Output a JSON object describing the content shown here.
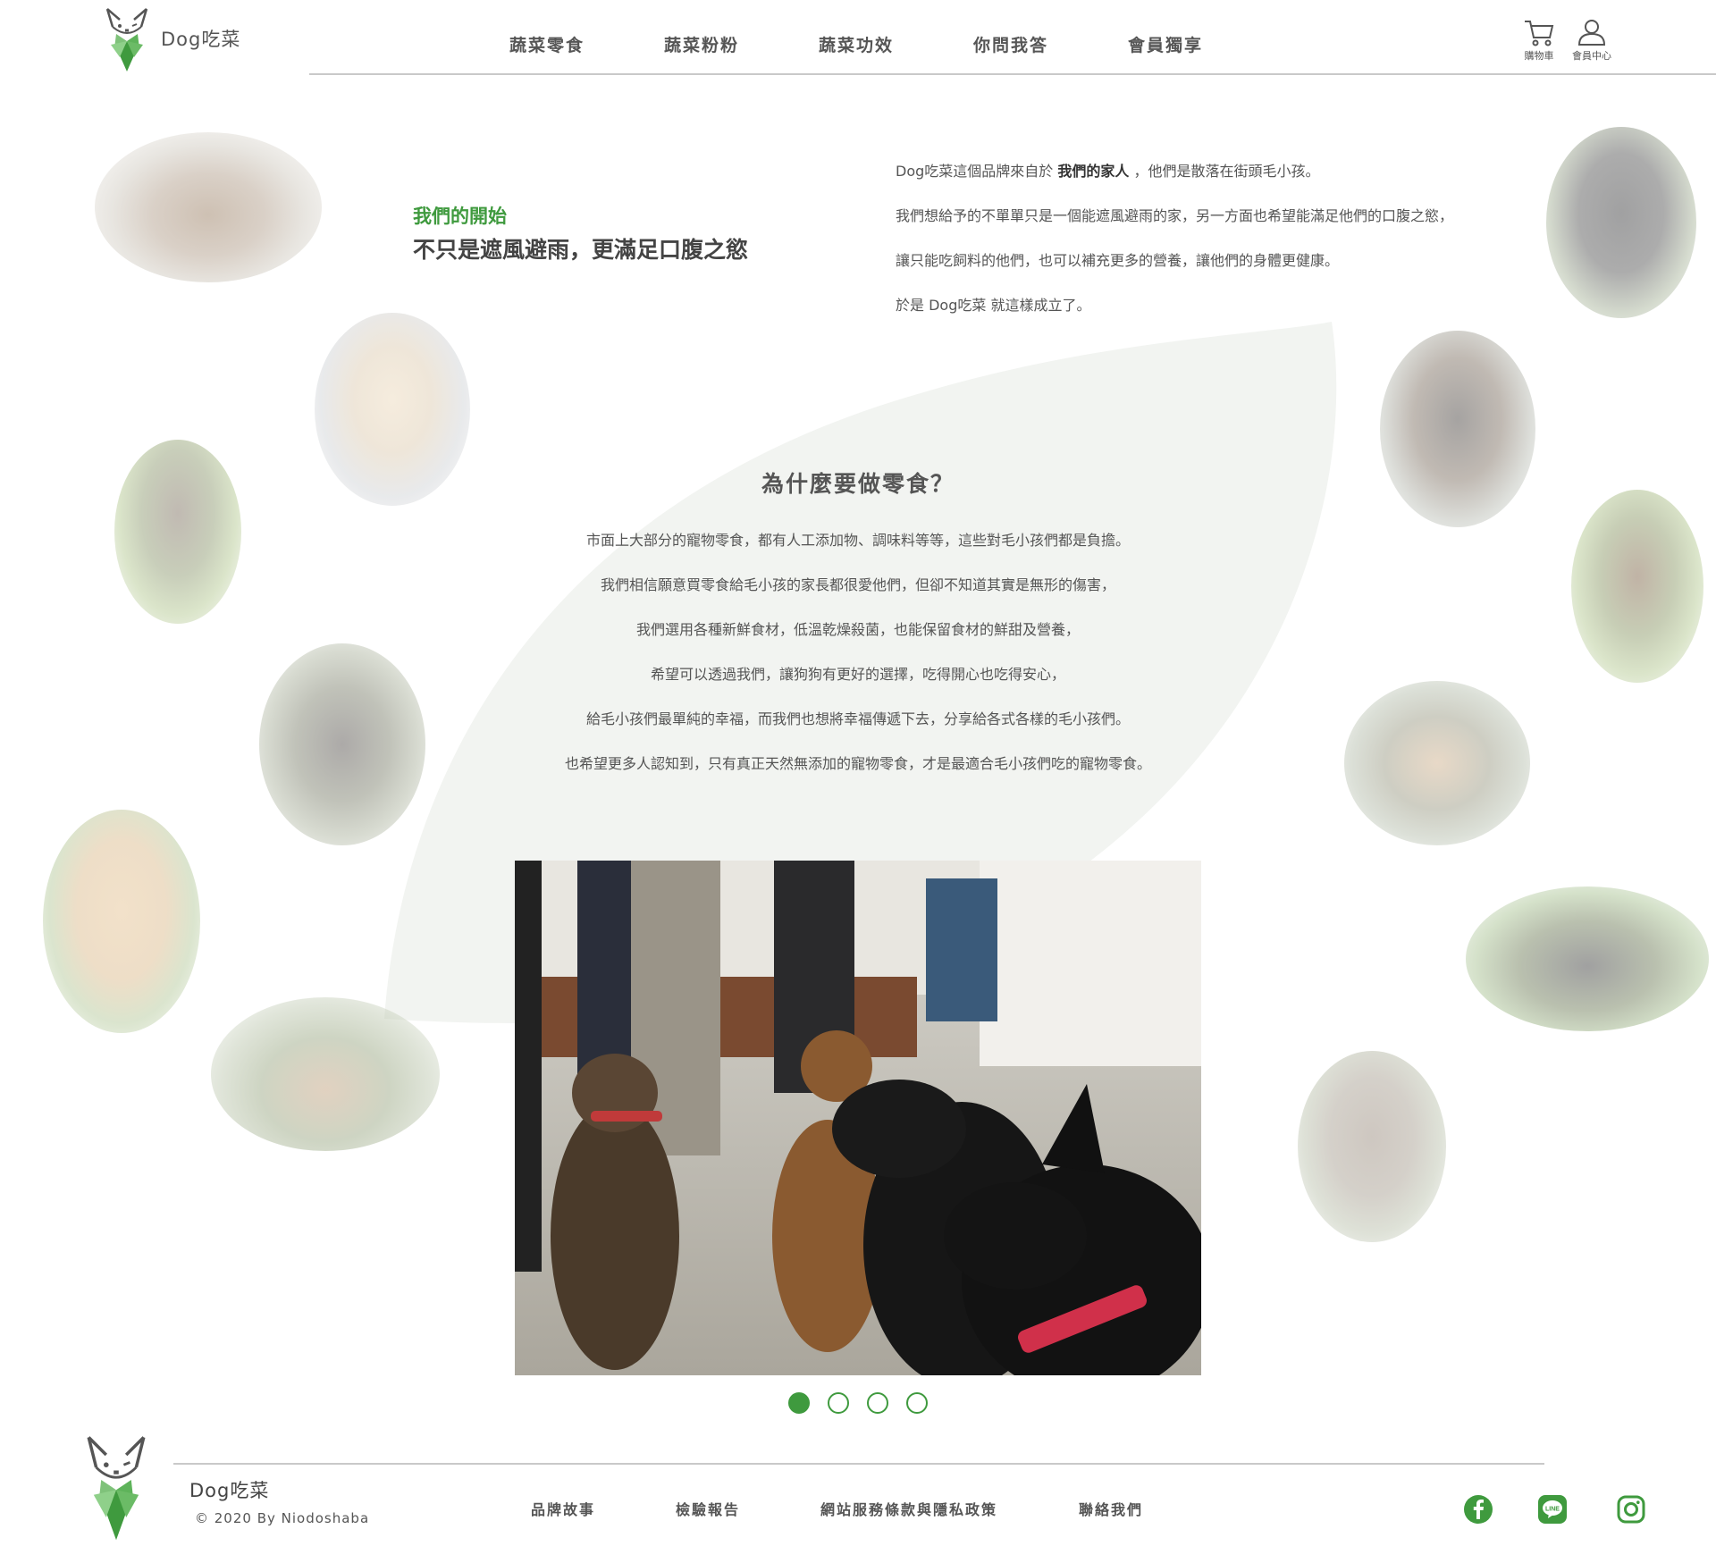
{
  "header": {
    "brand": "Dog吃菜",
    "nav": [
      "蔬菜零食",
      "蔬菜粉粉",
      "蔬菜功效",
      "你問我答",
      "會員獨享"
    ],
    "cart_label": "購物車",
    "member_label": "會員中心"
  },
  "intro": {
    "kicker": "我們的開始",
    "title": "不只是遮風避雨，更滿足口腹之慾",
    "p1_before": "Dog吃菜這個品牌來自於 ",
    "p1_bold": "我們的家人",
    "p1_after": " ，他們是散落在街頭毛小孩。",
    "p2": "我們想給予的不單單只是一個能遮風避雨的家，另一方面也希望能滿足他們的口腹之慾，",
    "p3": "讓只能吃飼料的他們，也可以補充更多的營養，讓他們的身體更健康。",
    "p4": "於是 Dog吃菜 就這樣成立了。"
  },
  "why": {
    "title": "為什麼要做零食？",
    "lines": [
      "市面上大部分的寵物零食，都有人工添加物、調味料等等，這些對毛小孩們都是負擔。",
      "我們相信願意買零食給毛小孩的家長都很愛他們，但卻不知道其實是無形的傷害，",
      "我們選用各種新鮮食材，低溫乾燥殺菌，也能保留食材的鮮甜及營養，",
      "希望可以透過我們，讓狗狗有更好的選擇，吃得開心也吃得安心，",
      "給毛小孩們最單純的幸福，而我們也想將幸福傳遞下去，分享給各式各樣的毛小孩們。",
      "也希望更多人認知到，只有真正天然無添加的寵物零食，才是最適合毛小孩們吃的寵物零食。"
    ]
  },
  "carousel": {
    "count": 4,
    "active_index": 0
  },
  "footer": {
    "brand": "Dog吃菜",
    "copyright": "© 2020 By Niodoshaba",
    "links": [
      "品牌故事",
      "檢驗報告",
      "網站服務條款與隱私政策",
      "聯絡我們"
    ],
    "social_icons": [
      "facebook-icon",
      "line-icon",
      "instagram-icon"
    ]
  },
  "colors": {
    "accent": "#3f9a3e",
    "leaf": "#f2f4f1",
    "text": "#555555"
  }
}
